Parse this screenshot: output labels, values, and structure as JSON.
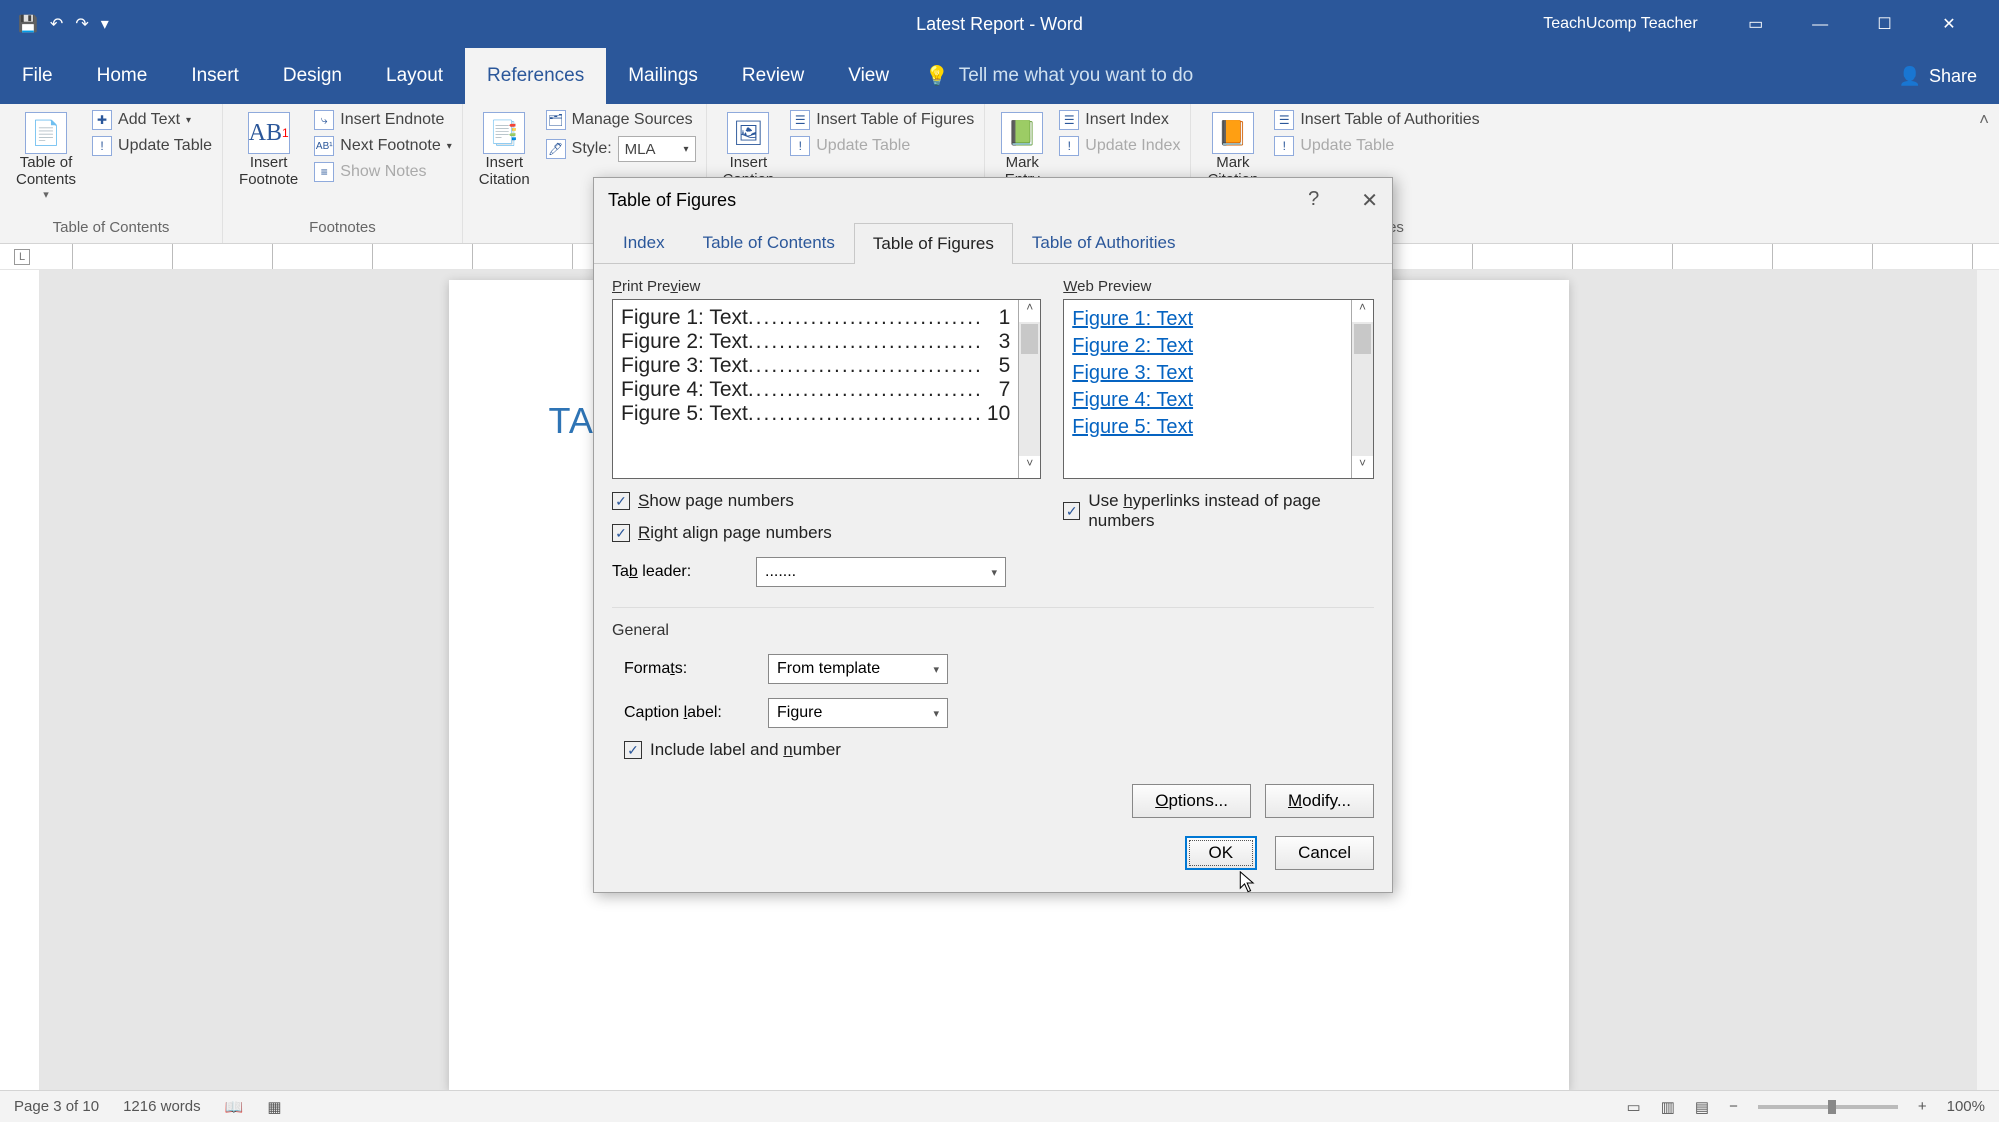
{
  "titlebar": {
    "title": "Latest Report - Word",
    "user": "TeachUcomp Teacher"
  },
  "tabs": {
    "items": [
      "File",
      "Home",
      "Insert",
      "Design",
      "Layout",
      "References",
      "Mailings",
      "Review",
      "View"
    ],
    "active": "References",
    "tellme": "Tell me what you want to do",
    "share": "Share"
  },
  "ribbon": {
    "toc": {
      "big": "Table of\nContents",
      "add_text": "Add Text",
      "update_table": "Update Table",
      "label": "Table of Contents"
    },
    "footnotes": {
      "big": "Insert\nFootnote",
      "insert_endnote": "Insert Endnote",
      "next_footnote": "Next Footnote",
      "show_notes": "Show Notes",
      "label": "Footnotes"
    },
    "citations": {
      "big": "Insert\nCitation",
      "manage_sources": "Manage Sources",
      "style_label": "Style:",
      "style_value": "MLA"
    },
    "captions": {
      "insert_caption": "Insert\nCaption",
      "insert_tof": "Insert Table of Figures",
      "update_table": "Update Table"
    },
    "index": {
      "big": "Mark\nEntry",
      "insert_index": "Insert Index",
      "update_index": "Update Index"
    },
    "toa": {
      "big": "Mark\nCitation",
      "insert_toa": "Insert Table of Authorities",
      "update_table": "Update Table",
      "label": "Table of Authorities"
    }
  },
  "document": {
    "heading": "TABLE"
  },
  "dialog": {
    "title": "Table of Figures",
    "tabs": [
      "Index",
      "Table of Contents",
      "Table of Figures",
      "Table of Authorities"
    ],
    "active_tab": "Table of Figures",
    "print_preview_label": "Print Preview",
    "web_preview_label": "Web Preview",
    "print_items": [
      {
        "label": "Figure 1: Text",
        "page": "1"
      },
      {
        "label": "Figure 2: Text",
        "page": "3"
      },
      {
        "label": "Figure 3: Text",
        "page": "5"
      },
      {
        "label": "Figure 4: Text",
        "page": "7"
      },
      {
        "label": "Figure 5: Text",
        "page": "10"
      }
    ],
    "web_items": [
      "Figure 1: Text",
      "Figure 2: Text",
      "Figure 3: Text",
      "Figure 4: Text",
      "Figure 5: Text"
    ],
    "show_page_numbers": "Show page numbers",
    "right_align": "Right align page numbers",
    "use_hyperlinks": "Use hyperlinks instead of page numbers",
    "tab_leader_label": "Tab leader:",
    "tab_leader_value": ".......",
    "general_label": "General",
    "formats_label": "Formats:",
    "formats_value": "From template",
    "caption_label_label": "Caption label:",
    "caption_label_value": "Figure",
    "include_label": "Include label and number",
    "options_btn": "Options...",
    "modify_btn": "Modify...",
    "ok": "OK",
    "cancel": "Cancel"
  },
  "statusbar": {
    "page": "Page 3 of 10",
    "words": "1216 words",
    "zoom": "100%"
  }
}
